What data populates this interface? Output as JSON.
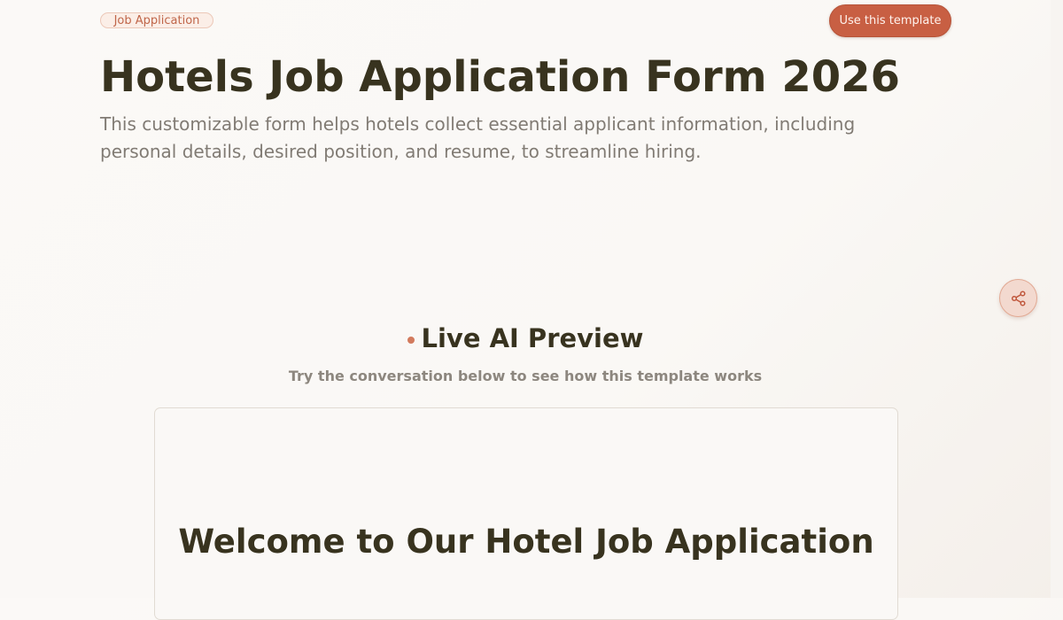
{
  "header": {
    "tag": "Job Application",
    "cta_label": "Use this template",
    "title": "Hotels Job Application Form 2026",
    "description": "This customizable form helps hotels collect essential applicant information, including personal details, desired position, and resume, to streamline hiring."
  },
  "share": {
    "icon": "share-icon"
  },
  "preview": {
    "title": "Live AI Preview",
    "subtitle": "Try the conversation below to see how this template works",
    "card_heading": "Welcome to Our Hotel Job Application"
  },
  "colors": {
    "accent": "#c85f43",
    "title": "#38331f",
    "muted": "#817b74",
    "background": "#fbf9f7"
  }
}
